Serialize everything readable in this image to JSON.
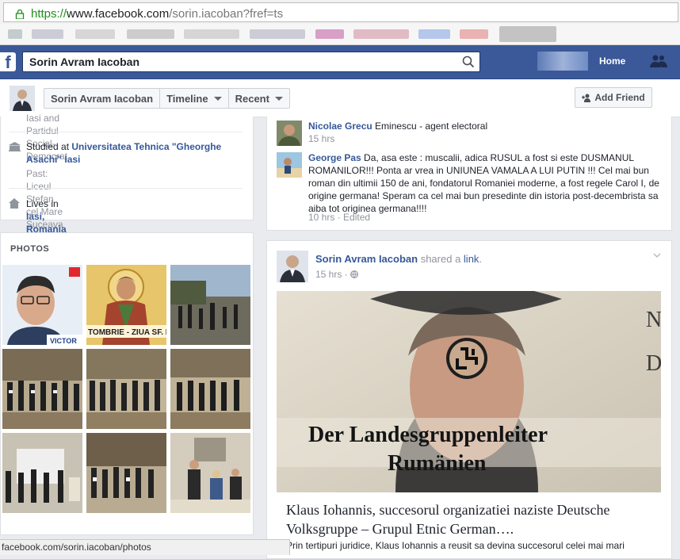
{
  "browser": {
    "url_scheme": "https://",
    "url_host": "www.facebook.com",
    "url_path": "/sorin.iacoban?fref=ts",
    "status_url": "facebook.com/sorin.iacoban/photos"
  },
  "topbar": {
    "logo": "f",
    "search_value": "Sorin Avram Iacoban",
    "home_label": "Home"
  },
  "profile_header": {
    "tabs": [
      {
        "label": "Sorin Avram Iacoban"
      },
      {
        "label": "Timeline"
      },
      {
        "label": "Recent"
      }
    ],
    "add_friend_label": "Add Friend"
  },
  "intro": {
    "cut_line": "Iasi and Partidul Social-Democrat",
    "studied_prefix": "Studied at ",
    "studied_school": "Universitatea Tehnica \"Gheorghe Asachi\" Iasi",
    "studied_past": "Past: Liceul Stefan cel Mare Suceava",
    "lives_prefix": "Lives in ",
    "lives_city": "Iasi, Romania"
  },
  "photos": {
    "label": "PHOTOS",
    "photo1_caption": "VICTOR",
    "photo2_caption": "TOMBRIE - ZIUA SF. D"
  },
  "comments": [
    {
      "name": "Nicolae Grecu",
      "text": "Eminescu - agent electoral",
      "time": "15 hrs"
    },
    {
      "name": "George Pas",
      "text": "Da, asa este : muscalii, adica RUSUL a fost si este DUSMANUL ROMANILOR!!! Ponta ar vrea in UNIUNEA VAMALA A LUI PUTIN !!! Cel mai bun roman din ultimii 150 de ani, fondatorul Romaniei moderne, a fost regele Carol I, de origine germana! Speram ca cel mai bun presedinte din istoria post-decembrista sa aiba tot originea germana!!!!",
      "time": "10 hrs",
      "edited": "Edited"
    }
  ],
  "post": {
    "author": "Sorin Avram Iacoban",
    "action": "shared a",
    "action_link": "link",
    "time": "15 hrs",
    "image_text_line1": "Der Landesgruppenleiter",
    "image_text_line2": "Rumänien",
    "link_title": "Klaus Iohannis, succesorul organizatiei naziste Deutsche Volksgruppe – Grupul Etnic German….",
    "link_desc": "Prin tertipuri juridice, Klaus Iohannis a reusit sa devina succesorul celei mai mari"
  },
  "colors": {
    "brand_blue": "#3b5998",
    "link_blue": "#365899",
    "url_green": "#1b8f1b"
  }
}
